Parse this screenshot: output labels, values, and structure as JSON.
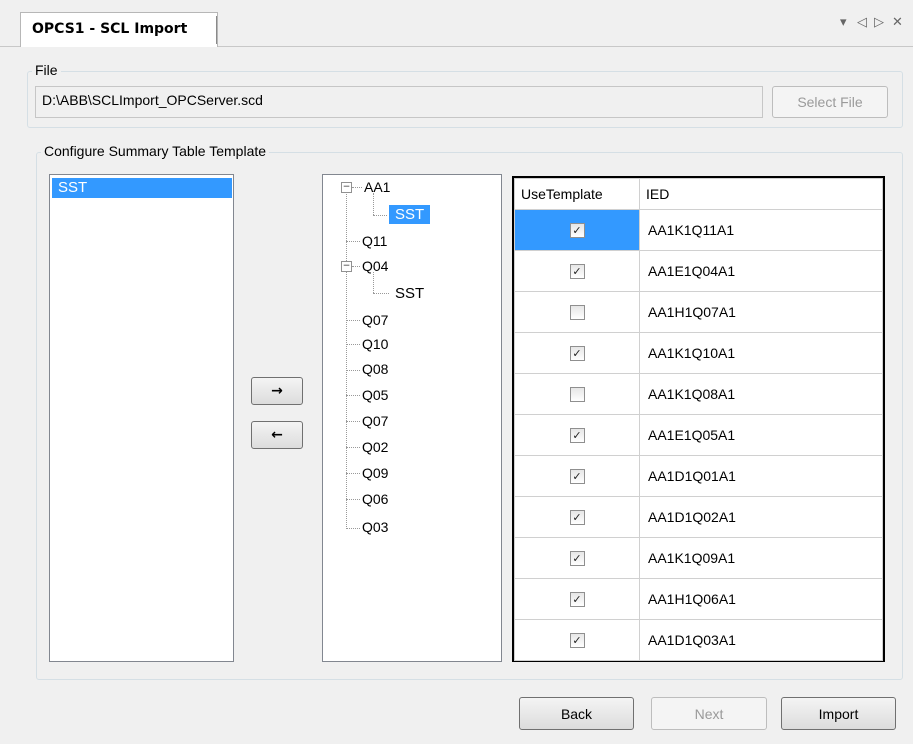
{
  "tab": {
    "title": "OPCS1 - SCL Import"
  },
  "window_controls": {
    "dropdown": "▾",
    "prev": "◁",
    "next": "▷",
    "close": "✕"
  },
  "file_group": {
    "legend": "File",
    "path": "D:\\ABB\\SCLImport_OPCServer.scd",
    "select_file_label": "Select File"
  },
  "config_group": {
    "legend": "Configure Summary Table Template"
  },
  "template_list": {
    "items": [
      "SST"
    ]
  },
  "arrows": {
    "right": "→",
    "left": "←"
  },
  "tree": {
    "root": "AA1",
    "root_child": "SST",
    "nodes": [
      "Q11",
      "Q04",
      "Q07",
      "Q10",
      "Q08",
      "Q05",
      "Q07",
      "Q02",
      "Q09",
      "Q06",
      "Q03"
    ],
    "q04_child": "SST"
  },
  "grid": {
    "columns": [
      "UseTemplate",
      "IED"
    ],
    "rows": [
      {
        "use_template": true,
        "ied": "AA1K1Q11A1"
      },
      {
        "use_template": true,
        "ied": "AA1E1Q04A1"
      },
      {
        "use_template": false,
        "ied": "AA1H1Q07A1"
      },
      {
        "use_template": true,
        "ied": "AA1K1Q10A1"
      },
      {
        "use_template": false,
        "ied": "AA1K1Q08A1"
      },
      {
        "use_template": true,
        "ied": "AA1E1Q05A1"
      },
      {
        "use_template": true,
        "ied": "AA1D1Q01A1"
      },
      {
        "use_template": true,
        "ied": "AA1D1Q02A1"
      },
      {
        "use_template": true,
        "ied": "AA1K1Q09A1"
      },
      {
        "use_template": true,
        "ied": "AA1H1Q06A1"
      },
      {
        "use_template": true,
        "ied": "AA1D1Q03A1"
      }
    ]
  },
  "footer": {
    "back_label": "Back",
    "next_label": "Next",
    "import_label": "Import"
  },
  "checkmark": "✓"
}
